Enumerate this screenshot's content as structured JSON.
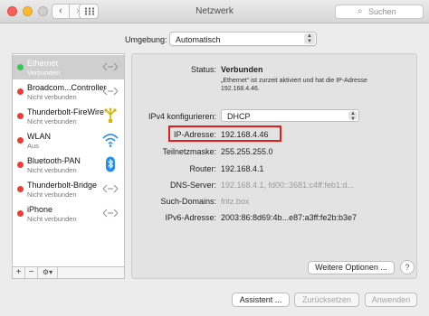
{
  "window": {
    "title": "Netzwerk"
  },
  "toolbar": {
    "back_glyph": "‹",
    "forward_glyph": "›",
    "search_placeholder": "Suchen",
    "search_icon": "magnifier-icon"
  },
  "location": {
    "label": "Umgebung:",
    "value": "Automatisch"
  },
  "services": [
    {
      "name": "Ethernet",
      "status": "Verbunden",
      "dot": "#34c759",
      "icon": "ethernet-icon",
      "selected": true
    },
    {
      "name": "Broadcom...Controller",
      "status": "Nicht verbunden",
      "dot": "#ee3b35",
      "icon": "ethernet-icon",
      "selected": false
    },
    {
      "name": "Thunderbolt-FireWire",
      "status": "Nicht verbunden",
      "dot": "#ee3b35",
      "icon": "firewire-icon",
      "selected": false
    },
    {
      "name": "WLAN",
      "status": "Aus",
      "dot": "#ee3b35",
      "icon": "wifi-icon",
      "selected": false
    },
    {
      "name": "Bluetooth-PAN",
      "status": "Nicht verbunden",
      "dot": "#ee3b35",
      "icon": "bluetooth-icon",
      "selected": false
    },
    {
      "name": "Thunderbolt-Bridge",
      "status": "Nicht verbunden",
      "dot": "#ee3b35",
      "icon": "ethernet-icon",
      "selected": false
    },
    {
      "name": "iPhone",
      "status": "Nicht verbunden",
      "dot": "#ee3b35",
      "icon": "phone-icon",
      "selected": false
    }
  ],
  "sidebar_footer": {
    "add": "+",
    "remove": "−",
    "gear": "⚙▾"
  },
  "detail": {
    "status_label": "Status:",
    "status_value": "Verbunden",
    "status_note": "„Ethernet“ ist zurzeit aktiviert und hat die IP-Adresse 192.168.4.46.",
    "ipv4_label": "IPv4 konfigurieren:",
    "ipv4_value": "DHCP",
    "ip_label": "IP-Adresse:",
    "ip_value": "192.168.4.46",
    "subnet_label": "Teilnetzmaske:",
    "subnet_value": "255.255.255.0",
    "router_label": "Router:",
    "router_value": "192.168.4.1",
    "dns_label": "DNS-Server:",
    "dns_value": "192.168.4.1, fd00::3681:c4ff:feb1:d...",
    "search_domains_label": "Such-Domains:",
    "search_domains_value": "fritz.box",
    "ipv6_label": "IPv6-Adresse:",
    "ipv6_value": "2003:86:8d69:4b...e87:a3ff:fe2b:b3e7",
    "advanced_button": "Weitere Optionen ...",
    "help_button": "?"
  },
  "buttons": {
    "assistant": "Assistent ...",
    "reset": "Zurücksetzen",
    "apply": "Anwenden"
  },
  "colors": {
    "highlight": "#e31b1b",
    "connected": "#34c759",
    "disconnected": "#ee3b35",
    "selected_row": "#cfcfcf"
  }
}
